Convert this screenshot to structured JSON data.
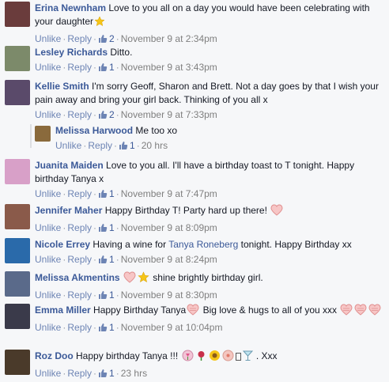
{
  "actions": {
    "unlike": "Unlike",
    "reply": "Reply",
    "dot": "·"
  },
  "comments": [
    {
      "author": "Erina Newnham",
      "text1": "Love to you all on a day you would have been celebrating with your daughter",
      "emoji": [
        "star-icon"
      ],
      "likes": "2",
      "time": "November 9 at 2:34pm",
      "avatar_color": "#6a3c3c"
    },
    {
      "author": "Lesley Richards",
      "text1": "Ditto.",
      "likes": "1",
      "time": "November 9 at 3:43pm",
      "avatar_color": "#7c8a6a"
    },
    {
      "author": "Kellie Smith",
      "text1": "I'm sorry Geoff, Sharon and Brett. Not a day goes by that I wish your pain away and bring your girl back. Thinking of you all x",
      "likes": "2",
      "time": "November 9 at 7:33pm",
      "avatar_color": "#5a4a6a"
    },
    {
      "author": "Melissa Harwood",
      "text1": "Me too xo",
      "likes": "1",
      "time": "20 hrs",
      "avatar_color": "#8a6a3c",
      "is_reply": true
    },
    {
      "author": "Juanita Maiden",
      "text1": "Love to you all. I'll have a birthday toast to T tonight. Happy birthday Tanya x",
      "likes": "1",
      "time": "November 9 at 7:47pm",
      "avatar_color": "#d8a0c8"
    },
    {
      "author": "Jennifer Maher",
      "text1": "Happy Birthday T! Party hard up there!",
      "emoji": [
        "heart-icon"
      ],
      "likes": "1",
      "time": "November 9 at 8:09pm",
      "avatar_color": "#8a5a4a"
    },
    {
      "author": "Nicole Errey",
      "text1": "Having a wine for",
      "mention": "Tanya Roneberg",
      "text2": "tonight. Happy Birthday xx",
      "likes": "1",
      "time": "November 9 at 8:24pm",
      "avatar_color": "#2a6aaa"
    },
    {
      "author": "Melissa Akmentins",
      "text1": "shine brightly birthday girl.",
      "emoji_before": [
        "heart-icon",
        "star-icon"
      ],
      "likes": "1",
      "time": "November 9 at 8:30pm",
      "avatar_color": "#5a6a8a"
    },
    {
      "author": "Emma Miller",
      "text1": "Happy Birthday Tanya",
      "text2": "Big love & hugs to all of you xxx",
      "likes": "1",
      "time": "November 9 at 10:04pm",
      "avatar_color": "#3a3a4a"
    },
    {
      "author": "Roz Doo",
      "text1": "Happy birthday Tanya !!!",
      "text2": ". Xxx",
      "likes": "1",
      "time": "23 hrs",
      "avatar_color": "#4a3a2a"
    }
  ]
}
